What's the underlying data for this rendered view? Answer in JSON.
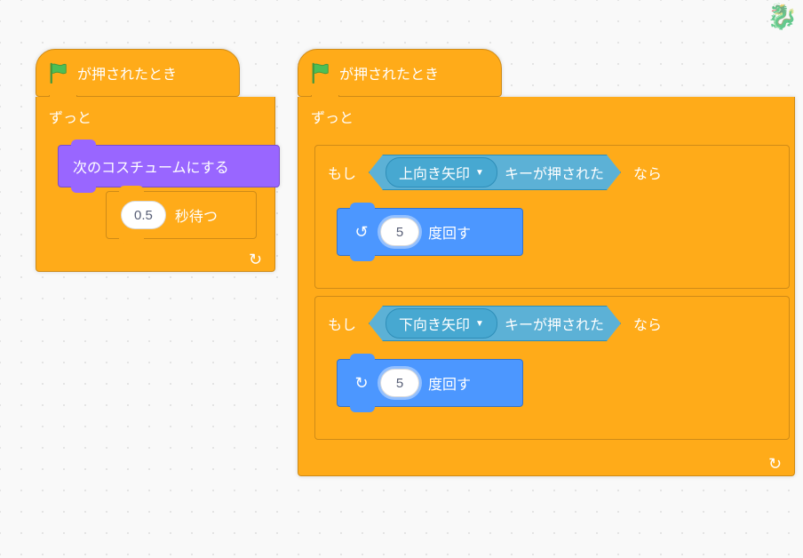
{
  "hat_label": "が押されたとき",
  "forever_label": "ずっと",
  "next_costume": "次のコスチュームにする",
  "wait_value": "0.5",
  "wait_suffix": "秒待つ",
  "if_label": "もし",
  "then_label": "なら",
  "key_up": "上向き矢印",
  "key_down": "下向き矢印",
  "key_pressed_suffix": "キーが押された",
  "turn_value_1": "5",
  "turn_value_2": "5",
  "turn_suffix": "度回す",
  "colors": {
    "events": "#ffab19",
    "control": "#ffab19",
    "looks": "#9966ff",
    "motion": "#4c97ff",
    "sensing": "#5cb1d6"
  }
}
